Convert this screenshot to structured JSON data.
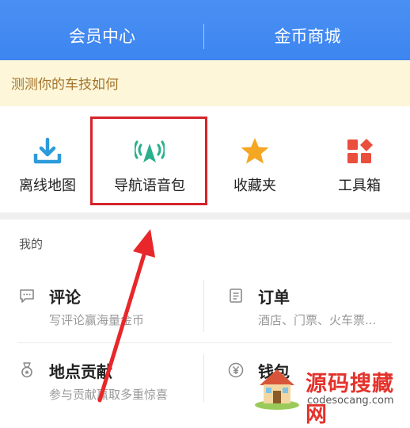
{
  "header": {
    "tab_left": "会员中心",
    "tab_right": "金币商城"
  },
  "notice": {
    "text": "测测你的车技如何"
  },
  "quick_items": [
    {
      "label": "离线地图",
      "icon": "download-icon"
    },
    {
      "label": "导航语音包",
      "icon": "voice-signal-icon"
    },
    {
      "label": "收藏夹",
      "icon": "star-icon"
    },
    {
      "label": "工具箱",
      "icon": "toolbox-icon"
    }
  ],
  "mine": {
    "title": "我的",
    "items": [
      {
        "title": "评论",
        "subtitle": "写评论赢海量金币",
        "icon": "comment-icon"
      },
      {
        "title": "订单",
        "subtitle": "酒店、门票、火车票...",
        "icon": "order-icon"
      },
      {
        "title": "地点贡献",
        "subtitle": "参与贡献赢取多重惊喜",
        "icon": "medal-icon"
      },
      {
        "title": "钱包",
        "subtitle": "",
        "icon": "wallet-icon"
      }
    ]
  },
  "watermark": {
    "brand": "源码搜藏网",
    "url": "codesocang.com"
  },
  "colors": {
    "header_blue": "#4a90f3",
    "highlight_red": "#d6232a",
    "notice_bg": "#fdf6d8"
  }
}
